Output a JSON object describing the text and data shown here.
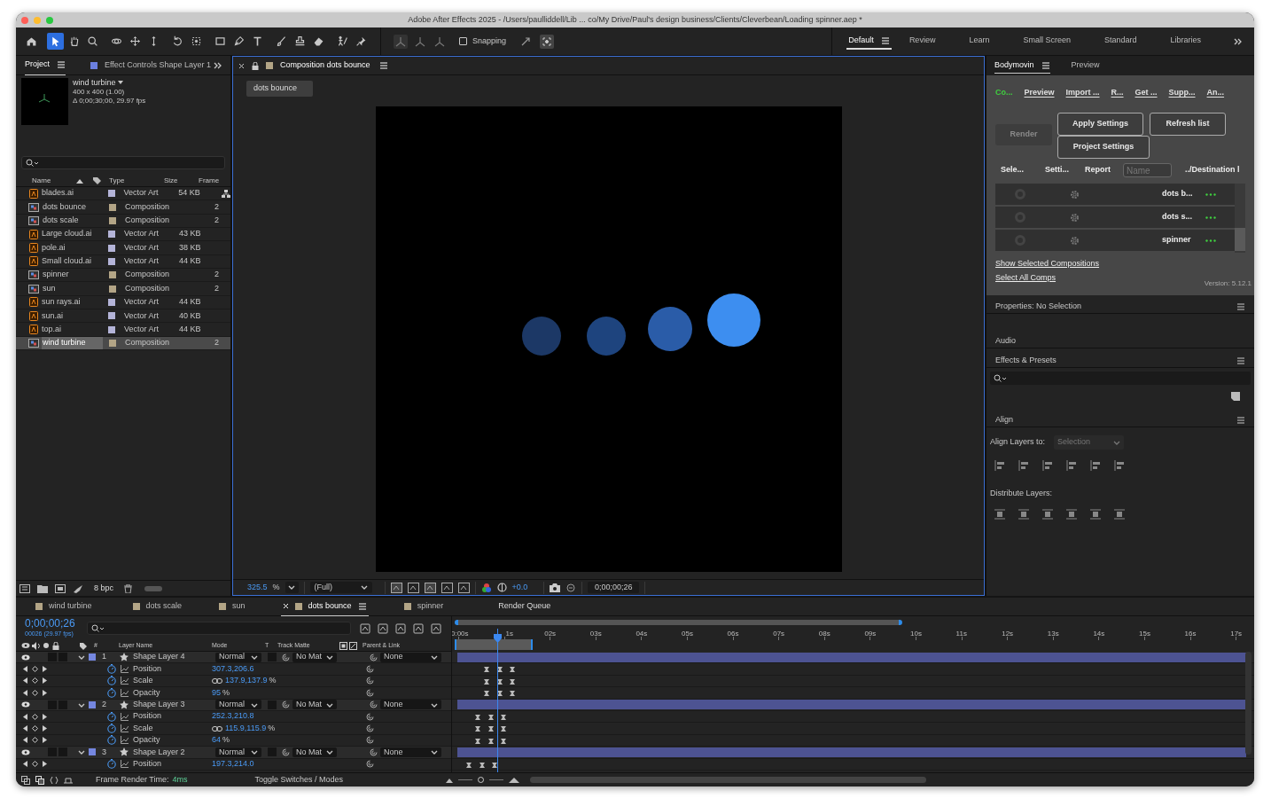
{
  "window": {
    "title": "Adobe After Effects 2025 - /Users/paulliddell/Lib ... co/My Drive/Paul's design business/Clients/Cleverbean/Loading spinner.aep *"
  },
  "toolbar": {
    "tools": [
      {
        "selected": false
      },
      {
        "selected": true
      },
      {
        "selected": false
      },
      {
        "selected": false
      },
      {
        "selected": false
      },
      {
        "selected": false
      },
      {
        "selected": false
      },
      {
        "selected": false
      },
      {
        "selected": false
      },
      {
        "selected": false
      },
      {
        "selected": false
      },
      {
        "selected": false
      },
      {
        "selected": false
      },
      {
        "selected": false
      },
      {
        "selected": false
      },
      {
        "selected": false
      },
      {
        "selected": false
      }
    ],
    "snapping": {
      "label": "Snapping",
      "checked": false
    }
  },
  "workspaces": [
    {
      "label": "Default",
      "selected": true
    },
    {
      "label": "Review",
      "selected": false
    },
    {
      "label": "Learn",
      "selected": false
    },
    {
      "label": "Small Screen",
      "selected": false
    },
    {
      "label": "Standard",
      "selected": false
    },
    {
      "label": "Libraries",
      "selected": false
    }
  ],
  "project": {
    "tabs": [
      {
        "label": "Project",
        "selected": true
      },
      {
        "label": "Effect Controls Shape Layer 1",
        "selected": false
      }
    ],
    "info": {
      "name": "wind turbine",
      "size": "400 x 400 (1.00)",
      "duration": "Δ 0;00;30;00, 29.97 fps"
    },
    "columns": [
      "Name",
      "Type",
      "Size",
      "Frame"
    ],
    "rows": [
      {
        "name": "blades.ai",
        "kind": "vector",
        "type": "Vector Art",
        "size": "54 KB",
        "selected": false
      },
      {
        "name": "dots bounce",
        "kind": "comp",
        "type": "Composition",
        "frame": "2",
        "selected": false
      },
      {
        "name": "dots scale",
        "kind": "comp",
        "type": "Composition",
        "frame": "2",
        "selected": false
      },
      {
        "name": "Large cloud.ai",
        "kind": "vector",
        "type": "Vector Art",
        "size": "43 KB",
        "selected": false
      },
      {
        "name": "pole.ai",
        "kind": "vector",
        "type": "Vector Art",
        "size": "38 KB",
        "selected": false
      },
      {
        "name": "Small cloud.ai",
        "kind": "vector",
        "type": "Vector Art",
        "size": "44 KB",
        "selected": false
      },
      {
        "name": "spinner",
        "kind": "comp",
        "type": "Composition",
        "frame": "2",
        "selected": false
      },
      {
        "name": "sun",
        "kind": "comp",
        "type": "Composition",
        "frame": "2",
        "selected": false
      },
      {
        "name": "sun rays.ai",
        "kind": "vector",
        "type": "Vector Art",
        "size": "44 KB",
        "selected": false
      },
      {
        "name": "sun.ai",
        "kind": "vector",
        "type": "Vector Art",
        "size": "40 KB",
        "selected": false
      },
      {
        "name": "top.ai",
        "kind": "vector",
        "type": "Vector Art",
        "size": "44 KB",
        "selected": false
      },
      {
        "name": "wind turbine",
        "kind": "comp",
        "type": "Composition",
        "frame": "2",
        "selected": true
      }
    ],
    "bit_depth": "8 bpc"
  },
  "viewer": {
    "tab": "Composition dots bounce",
    "breadcrumb": "dots bounce",
    "zoom": "325.5",
    "zoom_unit": "%",
    "resolution": "(Full)",
    "exposure": "+0.0",
    "timecode": "0;00;00;26"
  },
  "bodymovin": {
    "tabs": [
      {
        "label": "Bodymovin",
        "selected": true
      },
      {
        "label": "Preview",
        "selected": false
      }
    ],
    "nav": [
      {
        "label": "Co...",
        "selected": true
      },
      {
        "label": "Preview",
        "selected": false
      },
      {
        "label": "Import ...",
        "selected": false
      },
      {
        "label": "R...",
        "selected": false
      },
      {
        "label": "Get ...",
        "selected": false
      },
      {
        "label": "Supp...",
        "selected": false
      },
      {
        "label": "An...",
        "selected": false
      }
    ],
    "render": {
      "label": "Render",
      "disabled": true
    },
    "apply": "Apply Settings",
    "project_settings": "Project Settings",
    "refresh": "Refresh list",
    "columns": [
      "Sele...",
      "Setti...",
      "Report"
    ],
    "name_placeholder": "Name",
    "destination": "../Destination l",
    "comps": [
      {
        "name": "dots b...",
        "selected": false
      },
      {
        "name": "dots s...",
        "selected": false
      },
      {
        "name": "spinner",
        "selected": false
      }
    ],
    "links": [
      "Show Selected Compositions",
      "Select All Comps"
    ],
    "version": "Version: 5.12.1"
  },
  "panels": {
    "properties": "Properties: No Selection",
    "audio": "Audio",
    "effects": "Effects & Presets",
    "align": "Align",
    "align_to_label": "Align Layers to:",
    "align_to": "Selection",
    "distribute": "Distribute Layers:"
  },
  "timeline": {
    "tabs": [
      {
        "label": "wind turbine",
        "selected": false
      },
      {
        "label": "dots scale",
        "selected": false
      },
      {
        "label": "sun",
        "selected": false
      },
      {
        "label": "dots bounce",
        "selected": true
      },
      {
        "label": "spinner",
        "selected": false
      }
    ],
    "render_queue": "Render Queue",
    "timecode": "0;00;00;26",
    "frame_info": "00026 (29.97 fps)",
    "columns": {
      "number": "#",
      "layer_name": "Layer Name",
      "mode": "Mode",
      "t": "T",
      "track_matte": "Track Matte",
      "parent": "Parent & Link"
    },
    "ticks": [
      "0:00s",
      "1s",
      "02s",
      "03s",
      "04s",
      "05s",
      "06s",
      "07s",
      "08s",
      "09s",
      "10s",
      "11s",
      "12s",
      "13s",
      "14s",
      "15s",
      "16s",
      "17s"
    ],
    "layers": [
      {
        "number": "1",
        "name": "Shape Layer 4",
        "mode": "Normal",
        "matte": "No Mat",
        "parent": "None",
        "properties": [
          {
            "name": "Position",
            "value": "307.3,206.6",
            "linked": false
          },
          {
            "name": "Scale",
            "value": "137.9,137.9",
            "unit": "%",
            "linked": true
          },
          {
            "name": "Opacity",
            "value": "95",
            "unit": "%",
            "linked": false
          }
        ]
      },
      {
        "number": "2",
        "name": "Shape Layer 3",
        "mode": "Normal",
        "matte": "No Mat",
        "parent": "None",
        "properties": [
          {
            "name": "Position",
            "value": "252.3,210.8",
            "linked": false
          },
          {
            "name": "Scale",
            "value": "115.9,115.9",
            "unit": "%",
            "linked": true
          },
          {
            "name": "Opacity",
            "value": "64",
            "unit": "%",
            "linked": false
          }
        ]
      },
      {
        "number": "3",
        "name": "Shape Layer 2",
        "mode": "Normal",
        "matte": "No Mat",
        "parent": "None",
        "properties": [
          {
            "name": "Position",
            "value": "197.3,214.0",
            "linked": false
          }
        ]
      }
    ],
    "render_time_label": "Frame Render Time:",
    "render_time": "4ms",
    "toggle": "Toggle Switches / Modes"
  }
}
